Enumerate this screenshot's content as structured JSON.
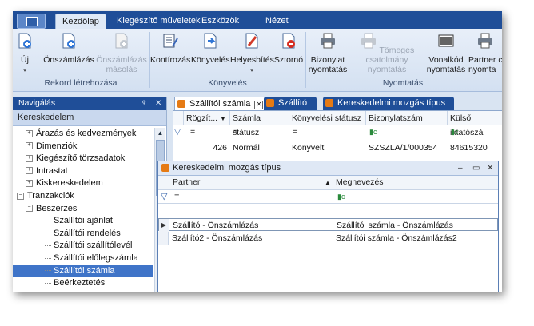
{
  "ribbon_tabs": [
    "Kezdőlap",
    "Kiegészítő műveletek",
    "Eszközök",
    "Nézet"
  ],
  "ribbon": {
    "groups": [
      {
        "label": "Rekord létrehozása",
        "buttons": [
          {
            "label": "Új",
            "enabled": true,
            "icon": "new-document-icon"
          },
          {
            "label": "Önszámlázás",
            "enabled": true,
            "icon": "new-document-icon"
          },
          {
            "label": "Önszámlázás másolás",
            "enabled": false,
            "icon": "copy-document-icon"
          }
        ]
      },
      {
        "label": "Könyvelés",
        "buttons": [
          {
            "label": "Kontírozás",
            "enabled": true,
            "icon": "ledger-icon"
          },
          {
            "label": "Könyvelés",
            "enabled": true,
            "icon": "post-arrow-icon"
          },
          {
            "label": "Helyesbítés",
            "enabled": true,
            "icon": "correction-icon"
          },
          {
            "label": "Sztornó",
            "enabled": true,
            "icon": "storno-icon"
          }
        ]
      },
      {
        "label": "Nyomtatás",
        "buttons": [
          {
            "label": "Bizonylat nyomtatás",
            "enabled": true,
            "icon": "printer-icon"
          },
          {
            "label": "Tömeges csatolmány nyomtatás",
            "enabled": false,
            "icon": "printer-icon"
          },
          {
            "label": "Vonalkód nyomtatás",
            "enabled": true,
            "icon": "barcode-icon"
          },
          {
            "label": "Partner c nyomta",
            "enabled": true,
            "icon": "printer-icon"
          }
        ]
      }
    ]
  },
  "nav": {
    "title": "Navigálás",
    "pin": "ᵠ",
    "close": "✕",
    "section": "Kereskedelem",
    "items": [
      {
        "label": "Árazás és kedvezmények",
        "level": 1,
        "expander": "+"
      },
      {
        "label": "Dimenziók",
        "level": 1,
        "expander": "+"
      },
      {
        "label": "Kiegészítő törzsadatok",
        "level": 1,
        "expander": "+"
      },
      {
        "label": "Intrastat",
        "level": 1,
        "expander": "+"
      },
      {
        "label": "Kiskereskedelem",
        "level": 1,
        "expander": "+"
      },
      {
        "label": "Tranzakciók",
        "level": 0,
        "expander": "−"
      },
      {
        "label": "Beszerzés",
        "level": 1,
        "expander": "−"
      },
      {
        "label": "Szállítói ajánlat",
        "level": 2,
        "expander": ""
      },
      {
        "label": "Szállítói rendelés",
        "level": 2,
        "expander": ""
      },
      {
        "label": "Szállítói szállítólevél",
        "level": 2,
        "expander": ""
      },
      {
        "label": "Szállítói előlegszámla",
        "level": 2,
        "expander": ""
      },
      {
        "label": "Szállítói számla",
        "level": 2,
        "expander": "",
        "selected": true
      },
      {
        "label": "Beérkeztetés",
        "level": 2,
        "expander": ""
      }
    ]
  },
  "doc_tabs": [
    {
      "label": "Szállítói számla",
      "active": true,
      "close": "✕"
    },
    {
      "label": "Szállító",
      "active": false
    },
    {
      "label": "Kereskedelmi mozgás típus",
      "active": false
    }
  ],
  "main_grid": {
    "columns": [
      "Rögzít...",
      "Számla státusz",
      "Könyvelési státusz",
      "Bizonylatszám",
      "Külső iktatószá"
    ],
    "filter": [
      "=",
      "=",
      "=",
      "▮c",
      "▮c"
    ],
    "filter_icon": "▽",
    "sort_indicator": "▼",
    "rows": [
      {
        "cells": [
          "426",
          "Normál",
          "Könyvelt",
          "SZSZLA/1/000354",
          "84615320"
        ]
      }
    ]
  },
  "popup": {
    "title": "Kereskedelmi mozgás típus",
    "controls": [
      "–",
      "▭",
      "✕"
    ],
    "columns": [
      "Partner",
      "Megnevezés"
    ],
    "sort_indicator": "▲",
    "filter": [
      "=",
      "▮c"
    ],
    "row_indicator": "▶",
    "rows": [
      {
        "partner": "Szállító - Önszámlázás",
        "name": "Szállítói számla - Önszámlázás",
        "current": true
      },
      {
        "partner": "Szállító2 - Önszámlázás",
        "name": "Szállítói számla - Önszámlázás2",
        "current": false
      }
    ]
  }
}
